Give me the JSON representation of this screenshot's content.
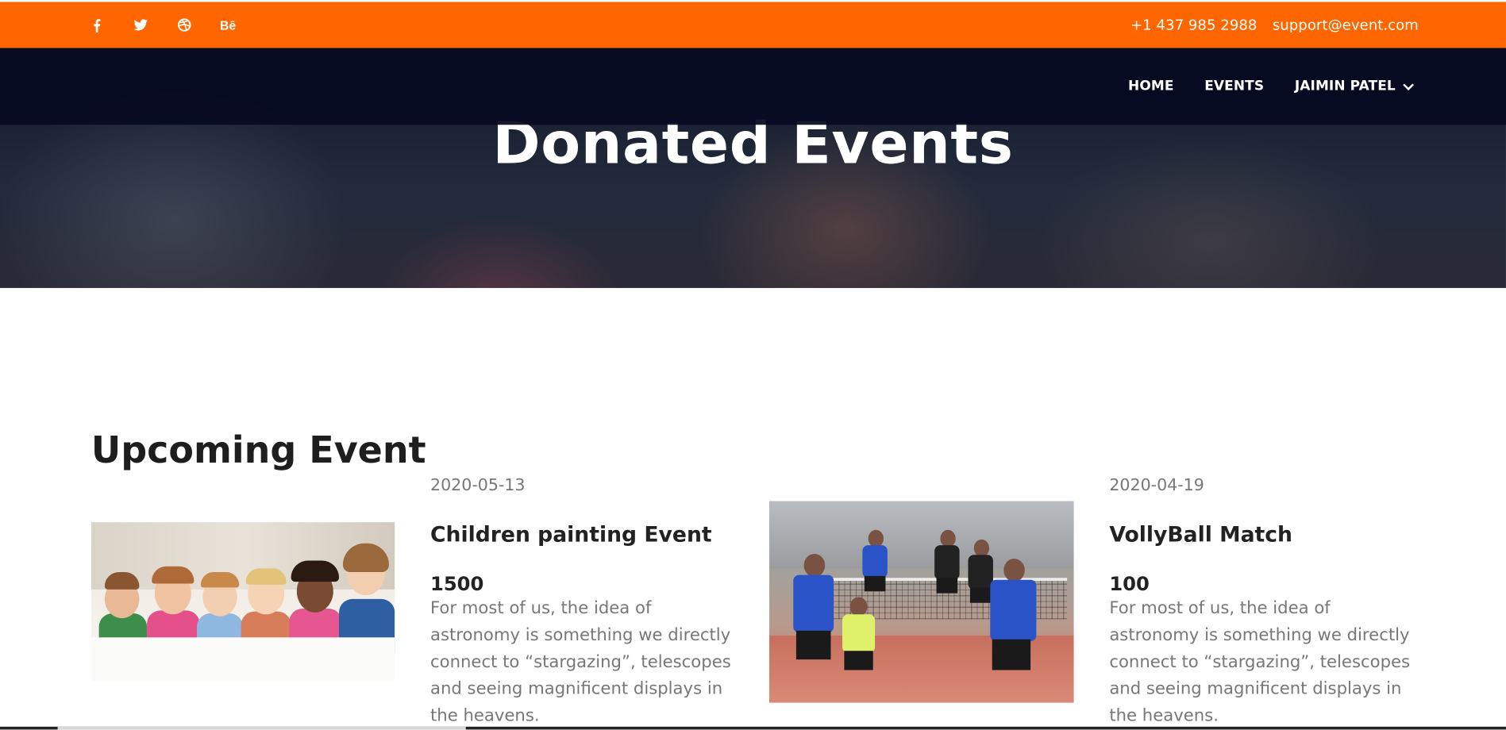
{
  "topbar": {
    "social": [
      {
        "icon": "facebook-icon",
        "glyph": "f"
      },
      {
        "icon": "twitter-icon",
        "glyph": "🐦"
      },
      {
        "icon": "dribbble-icon",
        "glyph": "⊛"
      },
      {
        "icon": "behance-icon",
        "glyph": "Bē"
      }
    ],
    "phone": "+1 437 985 2988",
    "email": "support@event.com",
    "background": "#ff6600"
  },
  "nav": {
    "items": [
      {
        "label": "HOME"
      },
      {
        "label": "EVENTS"
      },
      {
        "label": "JAIMIN PATEL"
      }
    ]
  },
  "hero": {
    "title": "Donated Events"
  },
  "section": {
    "title": "Upcoming Event"
  },
  "events": [
    {
      "date": "2020-05-13",
      "title": "Children painting Event",
      "amount": "1500",
      "description": "For most of us, the idea of astronomy is something we directly connect to “stargazing”, telescopes and seeing magnificent displays in the heavens.",
      "image": "children-painting-photo"
    },
    {
      "date": "2020-04-19",
      "title": "VollyBall Match",
      "amount": "100",
      "description": "For most of us, the idea of astronomy is something we directly connect to “stargazing”, telescopes and seeing magnificent displays in the heavens.",
      "image": "volleyball-match-photo"
    }
  ]
}
